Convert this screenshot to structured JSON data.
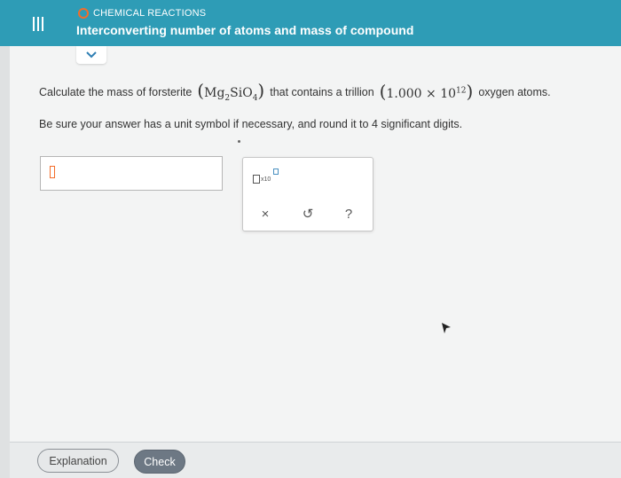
{
  "header": {
    "topic_label": "CHEMICAL REACTIONS",
    "title": "Interconverting number of atoms and mass of compound",
    "bar_color": "#2e9cb6",
    "topic_circle_color": "#f36d2a",
    "menu_icon": "hamburger-icon",
    "collapse_icon": "chevron-down-icon"
  },
  "question": {
    "lead": "Calculate the mass of forsterite",
    "formula": {
      "mg": "Mg",
      "mg_sub": "2",
      "si": "SiO",
      "o_sub": "4"
    },
    "mid": "that contains a trillion",
    "quantity": {
      "coef": "1.000",
      "times": "×",
      "base": "10",
      "exp": "12"
    },
    "tail": "oxygen atoms."
  },
  "instruction": "Be sure your answer has a unit symbol if necessary, and round it to 4 significant digits.",
  "answer": {
    "value": ""
  },
  "tools": {
    "x10_label": "x10",
    "clear_symbol": "×",
    "undo_symbol": "↺",
    "help_symbol": "?"
  },
  "footer": {
    "explanation_label": "Explanation",
    "check_label": "Check"
  }
}
